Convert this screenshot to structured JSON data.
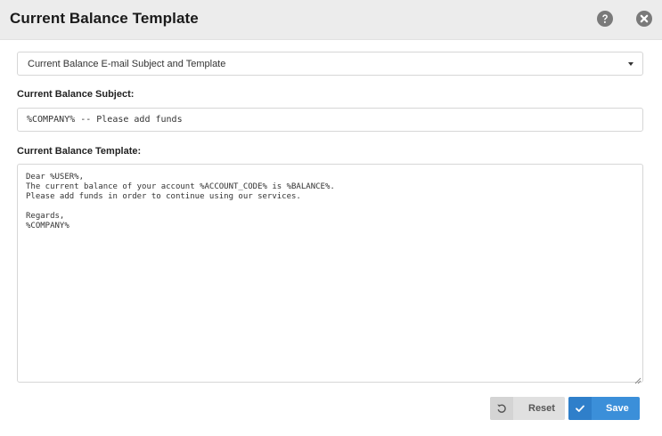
{
  "dialog": {
    "title": "Current Balance Template",
    "help_icon": "help-circle-icon",
    "close_icon": "close-circle-icon"
  },
  "template_select": {
    "selected": "Current Balance E-mail Subject and Template"
  },
  "subject": {
    "label": "Current Balance Subject:",
    "value": "%COMPANY% -- Please add funds"
  },
  "template": {
    "label": "Current Balance Template:",
    "value": "Dear %USER%,\nThe current balance of your account %ACCOUNT_CODE% is %BALANCE%.\nPlease add funds in order to continue using our services.\n\nRegards,\n%COMPANY%"
  },
  "buttons": {
    "reset_label": "Reset",
    "reset_icon": "undo-icon",
    "save_label": "Save",
    "save_icon": "check-icon"
  },
  "colors": {
    "header_bg": "#ececec",
    "save_bg": "#3b8fd9",
    "reset_bg": "#e0e0e0",
    "icon_gray": "#7a7a7a"
  }
}
